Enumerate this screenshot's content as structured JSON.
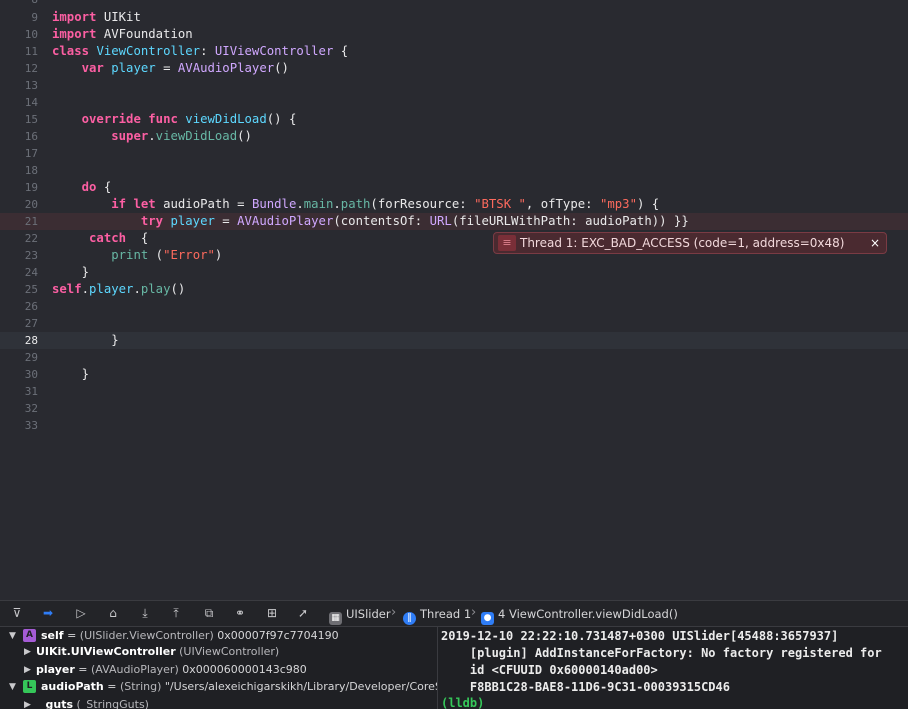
{
  "editor": {
    "top_partial_line_number": "8",
    "lines": [
      {
        "n": "9"
      },
      {
        "n": "10"
      },
      {
        "n": "11"
      },
      {
        "n": "12"
      },
      {
        "n": "13"
      },
      {
        "n": "14"
      },
      {
        "n": "15"
      },
      {
        "n": "16"
      },
      {
        "n": "17"
      },
      {
        "n": "18"
      },
      {
        "n": "19"
      },
      {
        "n": "20"
      },
      {
        "n": "21"
      },
      {
        "n": "22"
      },
      {
        "n": "23"
      },
      {
        "n": "24"
      },
      {
        "n": "25"
      },
      {
        "n": "26"
      },
      {
        "n": "27"
      },
      {
        "n": "28"
      },
      {
        "n": "29"
      },
      {
        "n": "30"
      },
      {
        "n": "31"
      },
      {
        "n": "32"
      },
      {
        "n": "33"
      }
    ],
    "tokens": {
      "import": "import",
      "uikit": "UIKit",
      "avfoundation": "AVFoundation",
      "class": "class",
      "viewcontroller": "ViewController",
      "colon": ": ",
      "uiviewcontroller": "UIViewController",
      "open_brace": " {",
      "var": "var",
      "player": "player",
      "eq": " = ",
      "avaudioplayer": "AVAudioPlayer",
      "parens": "()",
      "override": "override",
      "func": "func",
      "viewdidload": "viewDidLoad",
      "parens_brace": "() {",
      "super": "super",
      "dot": ".",
      "do": "do",
      "if": "if",
      "let": "let",
      "audiopath": "audioPath",
      "bundle": "Bundle",
      "main": "main",
      "path": "path",
      "forresource": "(forResource: ",
      "btsk": "\"BTSK \"",
      "oftype": ", ofType: ",
      "mp3": "\"mp3\"",
      "close_brace_open": ") {",
      "try": "try",
      "contentsof": "(contentsOf: ",
      "url": "URL",
      "fileurl": "(fileURLWithPath: audioPath)) }}",
      "catch": "catch",
      "catch_brace": "  {",
      "print": "print",
      "print_open": " (",
      "error_str": "\"Error\"",
      "close_paren": ")",
      "close_brace": "}",
      "self": "self",
      "play": "play"
    },
    "error_banner": {
      "text": "Thread 1: EXC_BAD_ACCESS (code=1, address=0x48)",
      "icon": "error-lines-icon",
      "close_icon": "×"
    },
    "current_line": "28",
    "error_line": "21"
  },
  "debug_bar": {
    "buttons": [
      {
        "icon": "hide-debug-area-icon",
        "glyph": "⊽"
      },
      {
        "icon": "breakpoints-toggle-icon",
        "glyph": "➡"
      },
      {
        "icon": "continue-icon",
        "glyph": "▷"
      },
      {
        "icon": "step-over-icon",
        "glyph": "⌂"
      },
      {
        "icon": "step-into-icon",
        "glyph": "⤓"
      },
      {
        "icon": "step-out-icon",
        "glyph": "⤒"
      },
      {
        "icon": "view-hierarchy-icon",
        "glyph": "⧉"
      },
      {
        "icon": "memory-graph-icon",
        "glyph": "⚭"
      },
      {
        "icon": "environment-overrides-icon",
        "glyph": "⊞"
      },
      {
        "icon": "simulate-location-icon",
        "glyph": "➚"
      }
    ],
    "breadcrumbs": {
      "app": "UISlider",
      "thread": "Thread 1",
      "frame": "4 ViewController.viewDidLoad()"
    },
    "accent": "#2f7df6"
  },
  "variables": [
    {
      "name": "self",
      "type": "(UISlider.ViewController)",
      "value": "0x00007f97c7704190",
      "badge": "A",
      "badge_color": "#a55bd6"
    },
    {
      "name": "UIKit.UIViewController",
      "type": "(UIViewController)",
      "value": ""
    },
    {
      "name": "player",
      "type": "(AVAudioPlayer)",
      "value": "0x000060000143c980"
    },
    {
      "name": "audioPath",
      "type": "(String)",
      "value": "\"/Users/alexeichigarskikh/Library/Developer/CoreSimul...",
      "badge": "L",
      "badge_color": "#35c759"
    },
    {
      "name": "_guts",
      "type": "(_StringGuts)",
      "value": ""
    }
  ],
  "console": {
    "lines": [
      "2019-12-10 22:22:10.731487+0300 UISlider[45488:3657937]",
      "    [plugin] AddInstanceForFactory: No factory registered for",
      "    id <CFUUID 0x60000140ad00>",
      "    F8BB1C28-BAE8-11D6-9C31-00039315CD46"
    ],
    "prompt": "(lldb)"
  }
}
